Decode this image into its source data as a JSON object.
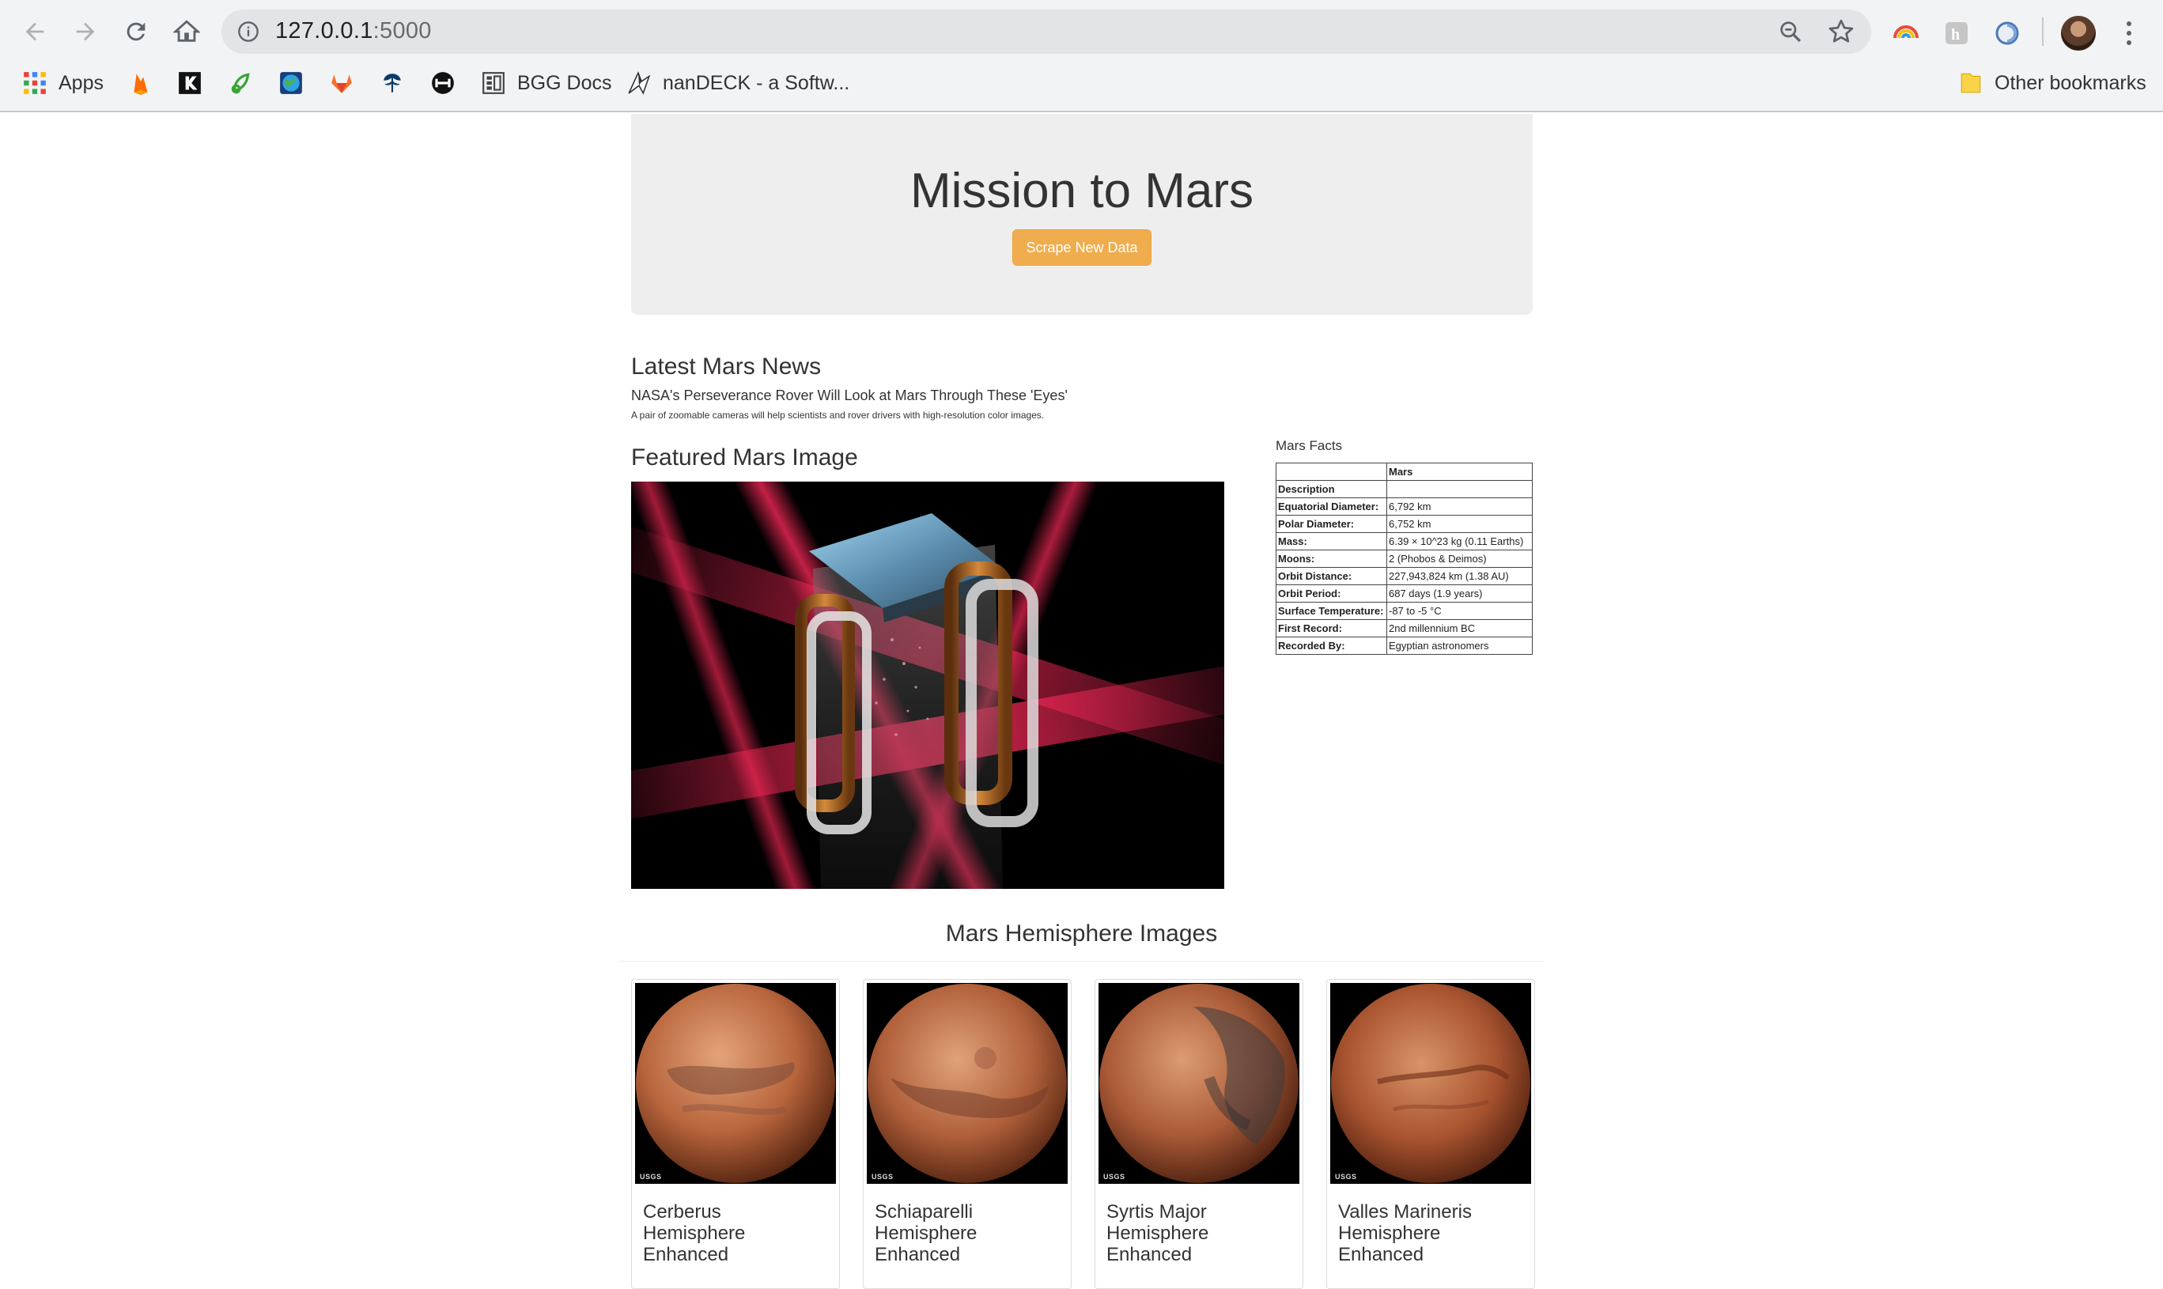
{
  "browser": {
    "url_host": "127.0.0.1",
    "url_port": ":5000",
    "bookmarks": [
      {
        "label": "Apps",
        "icon": "apps-grid-icon"
      },
      {
        "label": "",
        "icon": "firebase-icon"
      },
      {
        "label": "",
        "icon": "kickstarter-icon"
      },
      {
        "label": "",
        "icon": "leaf-icon"
      },
      {
        "label": "",
        "icon": "globe-icon"
      },
      {
        "label": "",
        "icon": "gitlab-icon"
      },
      {
        "label": "",
        "icon": "tree-icon"
      },
      {
        "label": "",
        "icon": "dumbbell-icon"
      },
      {
        "label": "BGG Docs",
        "icon": "doc-grid-icon"
      },
      {
        "label": "nanDECK - a Softw...",
        "icon": "nandeck-icon"
      }
    ],
    "other_bookmarks": "Other bookmarks"
  },
  "header": {
    "title": "Mission to Mars",
    "scrape_button": "Scrape New Data"
  },
  "news": {
    "heading": "Latest Mars News",
    "title": "NASA's Perseverance Rover Will Look at Mars Through These 'Eyes'",
    "paragraph": "A pair of zoomable cameras will help scientists and rover drivers with high-resolution color images."
  },
  "featured": {
    "heading": "Featured Mars Image"
  },
  "facts": {
    "heading": "Mars Facts",
    "column_header": "Mars",
    "index_header": "Description",
    "rows": [
      {
        "key": "Equatorial Diameter:",
        "value": "6,792 km"
      },
      {
        "key": "Polar Diameter:",
        "value": "6,752 km"
      },
      {
        "key": "Mass:",
        "value": "6.39 × 10^23 kg (0.11 Earths)"
      },
      {
        "key": "Moons:",
        "value": "2 (Phobos & Deimos)"
      },
      {
        "key": "Orbit Distance:",
        "value": "227,943,824 km (1.38 AU)"
      },
      {
        "key": "Orbit Period:",
        "value": "687 days (1.9 years)"
      },
      {
        "key": "Surface Temperature:",
        "value": "-87 to -5 °C"
      },
      {
        "key": "First Record:",
        "value": "2nd millennium BC"
      },
      {
        "key": "Recorded By:",
        "value": "Egyptian astronomers"
      }
    ]
  },
  "hemispheres": {
    "heading": "Mars Hemisphere Images",
    "items": [
      {
        "title": "Cerberus Hemisphere Enhanced"
      },
      {
        "title": "Schiaparelli Hemisphere Enhanced"
      },
      {
        "title": "Syrtis Major Hemisphere Enhanced"
      },
      {
        "title": "Valles Marineris Hemisphere Enhanced"
      }
    ],
    "watermark": "USGS"
  },
  "colors": {
    "accent_button": "#f0ad4e",
    "jumbotron_bg": "#eeeeee"
  }
}
